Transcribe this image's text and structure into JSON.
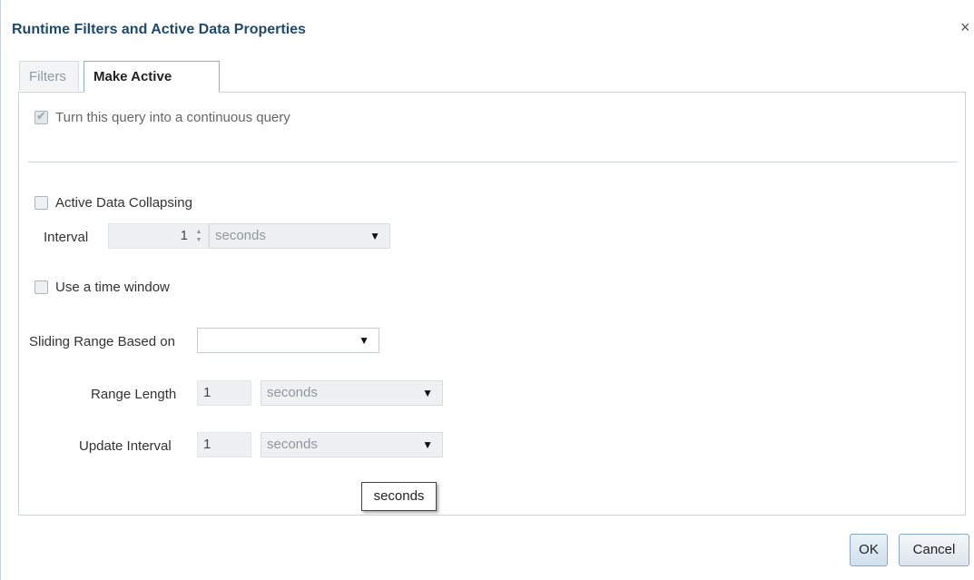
{
  "dialog": {
    "title": "Runtime Filters and Active Data Properties",
    "close_symbol": "×"
  },
  "tabs": [
    {
      "label": "Filters",
      "active": false
    },
    {
      "label": "Make Active",
      "active": true
    }
  ],
  "make_active": {
    "continuous_query": {
      "label": "Turn this query into a continuous query",
      "checked": true,
      "disabled": true
    },
    "active_data_collapsing": {
      "label": "Active Data Collapsing",
      "checked": false
    },
    "interval": {
      "label": "Interval",
      "value": "1",
      "unit": "seconds"
    },
    "time_window": {
      "label": "Use a time window",
      "checked": false
    },
    "sliding_range": {
      "label": "Sliding Range Based on",
      "value": ""
    },
    "range_length": {
      "label": "Range Length",
      "value": "1",
      "unit": "seconds"
    },
    "update_interval": {
      "label": "Update Interval",
      "value": "1",
      "unit": "seconds"
    }
  },
  "tooltip": {
    "text": "seconds"
  },
  "buttons": {
    "ok": "OK",
    "cancel": "Cancel"
  },
  "icons": {
    "dropdown": "▼",
    "spin_up": "▲",
    "spin_down": "▼",
    "check": "✔"
  },
  "colors": {
    "title": "#1f4a6e",
    "border": "#c9d3dd",
    "field_bg": "#eef0f2"
  }
}
